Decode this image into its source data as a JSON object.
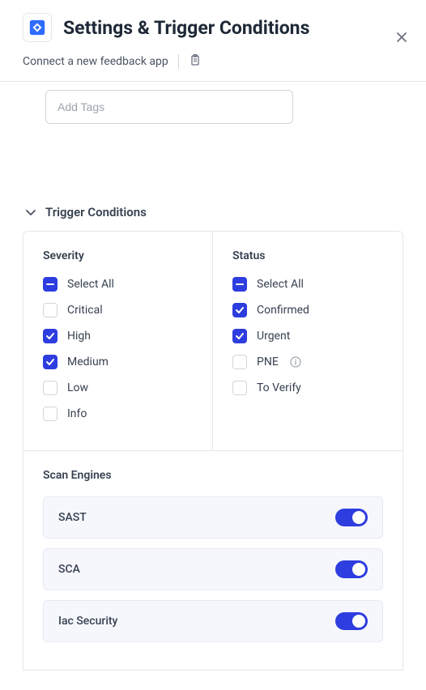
{
  "header": {
    "title": "Settings & Trigger Conditions",
    "subtitle": "Connect a new feedback app"
  },
  "tags": {
    "placeholder": "Add Tags"
  },
  "trigger": {
    "title": "Trigger Conditions",
    "severity": {
      "title": "Severity",
      "selectAll": "Select All",
      "items": [
        {
          "label": "Critical",
          "checked": false
        },
        {
          "label": "High",
          "checked": true
        },
        {
          "label": "Medium",
          "checked": true
        },
        {
          "label": "Low",
          "checked": false
        },
        {
          "label": "Info",
          "checked": false
        }
      ]
    },
    "status": {
      "title": "Status",
      "selectAll": "Select All",
      "items": [
        {
          "label": "Confirmed",
          "checked": true
        },
        {
          "label": "Urgent",
          "checked": true
        },
        {
          "label": "PNE",
          "checked": false,
          "info": true
        },
        {
          "label": "To Verify",
          "checked": false
        }
      ]
    }
  },
  "engines": {
    "title": "Scan Engines",
    "items": [
      {
        "label": "SAST",
        "on": true
      },
      {
        "label": "SCA",
        "on": true
      },
      {
        "label": "Iac Security",
        "on": true
      }
    ]
  }
}
